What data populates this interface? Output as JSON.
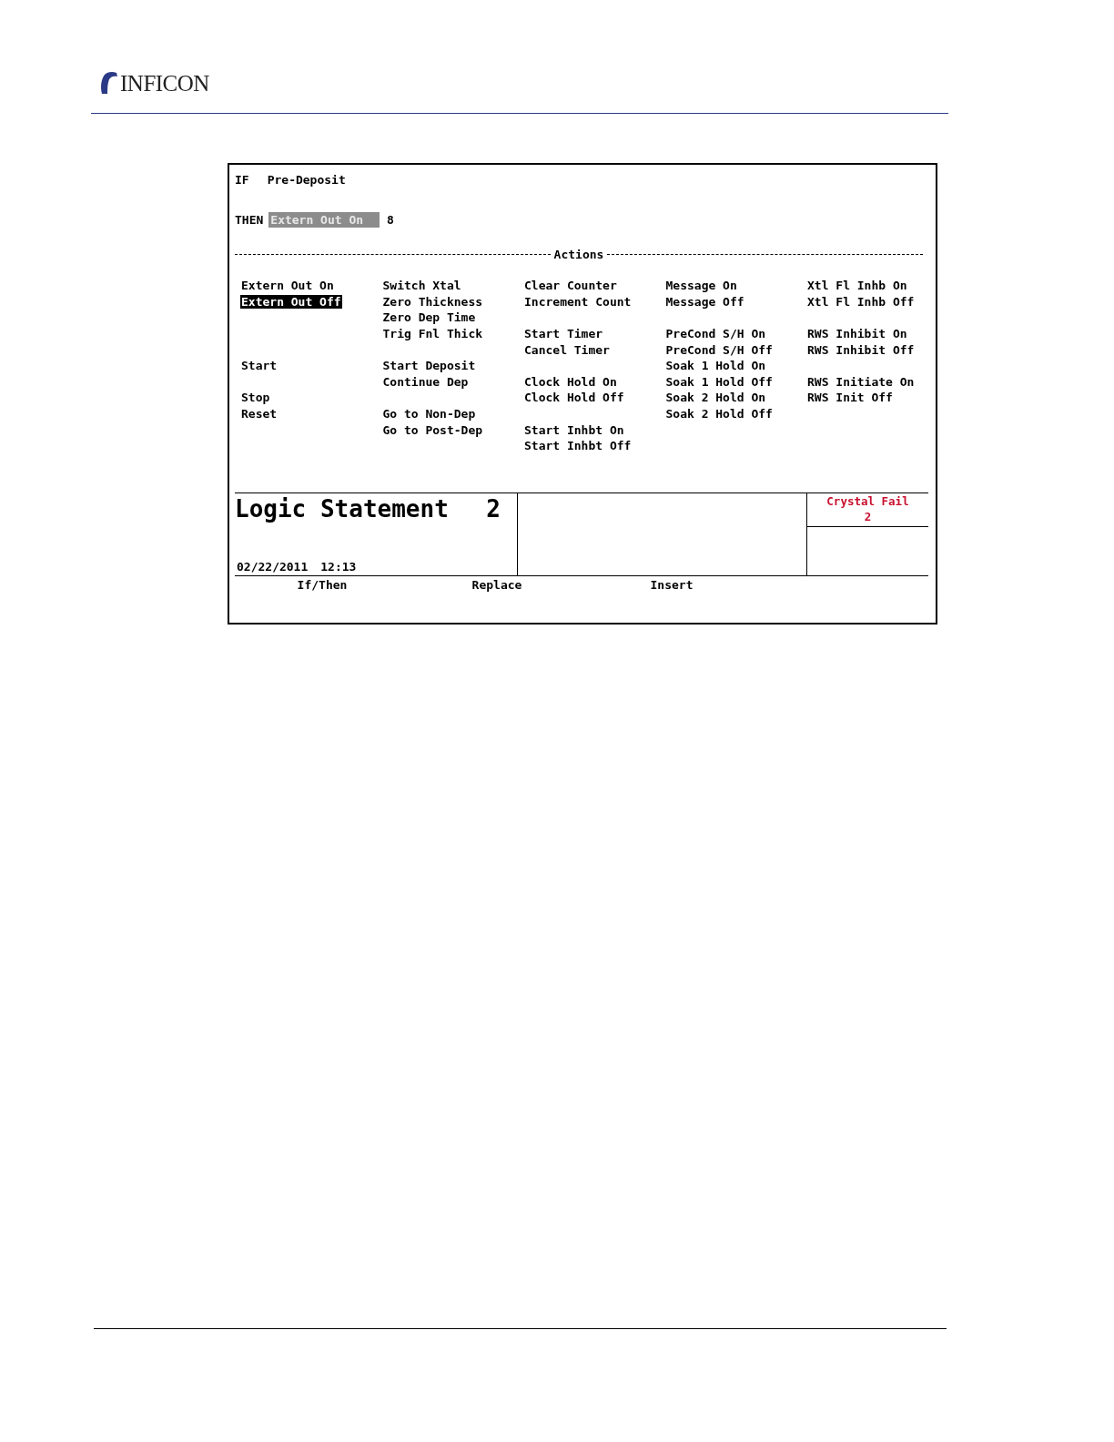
{
  "header": {
    "logo_text": "INFICON"
  },
  "screen": {
    "if_line": {
      "label": "IF",
      "value": "Pre-Deposit"
    },
    "then_line": {
      "label": "THEN",
      "value": "Extern Out On",
      "number": "8"
    },
    "actions_heading": "Actions",
    "action_columns": [
      [
        "Extern Out On",
        {
          "label": "Extern Out Off",
          "selected": true
        },
        null,
        null,
        null,
        "Start",
        null,
        "Stop",
        "Reset",
        null,
        null
      ],
      [
        "Switch Xtal",
        "Zero Thickness",
        "Zero Dep Time",
        "Trig Fnl Thick",
        null,
        "Start Deposit",
        "Continue Dep",
        null,
        "Go to Non-Dep",
        "Go to Post-Dep",
        null
      ],
      [
        "Clear Counter",
        "Increment Count",
        null,
        "Start Timer",
        "Cancel Timer",
        null,
        "Clock Hold On",
        "Clock Hold Off",
        null,
        "Start Inhbt On",
        "Start Inhbt Off"
      ],
      [
        "Message On",
        "Message Off",
        null,
        "PreCond S/H On",
        "PreCond S/H Off",
        "Soak 1 Hold On",
        "Soak 1 Hold Off",
        "Soak 2 Hold On",
        "Soak 2 Hold Off",
        null,
        null
      ],
      [
        "Xtl Fl Inhb On",
        "Xtl Fl Inhb Off",
        null,
        "RWS Inhibit On",
        "RWS Inhibit Off",
        null,
        "RWS Initiate On",
        "RWS Init Off",
        null,
        null,
        null
      ]
    ],
    "status": {
      "title": "Logic Statement",
      "number": "2",
      "date": "02/22/2011",
      "time": "12:13",
      "alarm": {
        "label": "Crystal Fail",
        "number": "2"
      }
    },
    "softkeys": [
      "If/Then",
      "Replace",
      "Insert"
    ]
  }
}
